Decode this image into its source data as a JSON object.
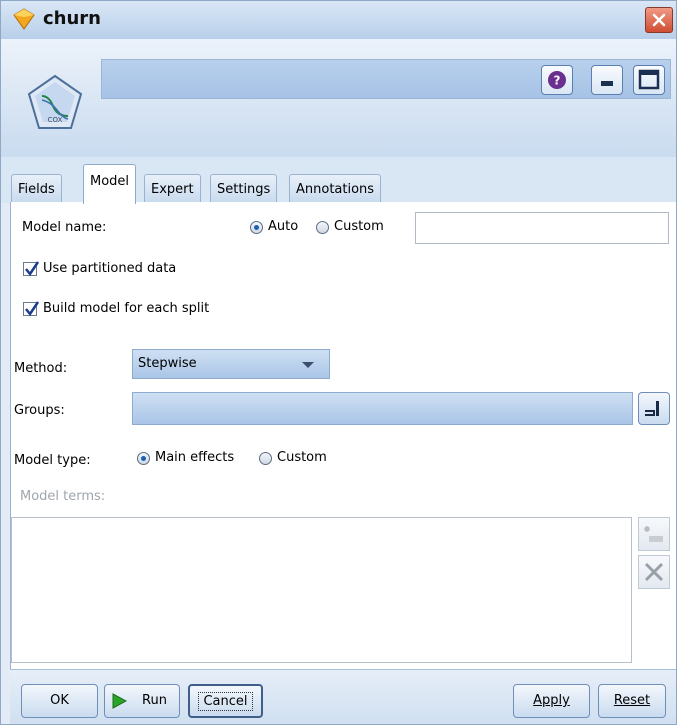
{
  "window": {
    "title": "churn"
  },
  "header": {
    "help_icon": "help-icon",
    "minimize_icon": "minimize-icon",
    "maximize_icon": "maximize-icon",
    "node_icon": "cox-node-icon",
    "node_icon_text": "COX"
  },
  "tabs": [
    {
      "label": "Fields"
    },
    {
      "label": "Model"
    },
    {
      "label": "Expert"
    },
    {
      "label": "Settings"
    },
    {
      "label": "Annotations"
    }
  ],
  "model": {
    "model_name_label": "Model name:",
    "auto_label": "Auto",
    "custom_label": "Custom",
    "model_name_selected": "Auto",
    "model_name_value": "",
    "use_partitioned_label": "Use partitioned data",
    "use_partitioned_checked": true,
    "build_split_label": "Build model for each split",
    "build_split_checked": true,
    "method_label": "Method:",
    "method_value": "Stepwise",
    "groups_label": "Groups:",
    "groups_value": "",
    "model_type_label": "Model type:",
    "main_effects_label": "Main effects",
    "model_type_custom_label": "Custom",
    "model_type_selected": "Main effects",
    "model_terms_label": "Model terms:"
  },
  "buttons": {
    "ok": "OK",
    "run": "Run",
    "cancel": "Cancel",
    "apply": "Apply",
    "reset": "Reset"
  },
  "colors": {
    "accent": "#1c5fb3",
    "run_green": "#2aa52a",
    "close_red": "#cf4d32"
  }
}
